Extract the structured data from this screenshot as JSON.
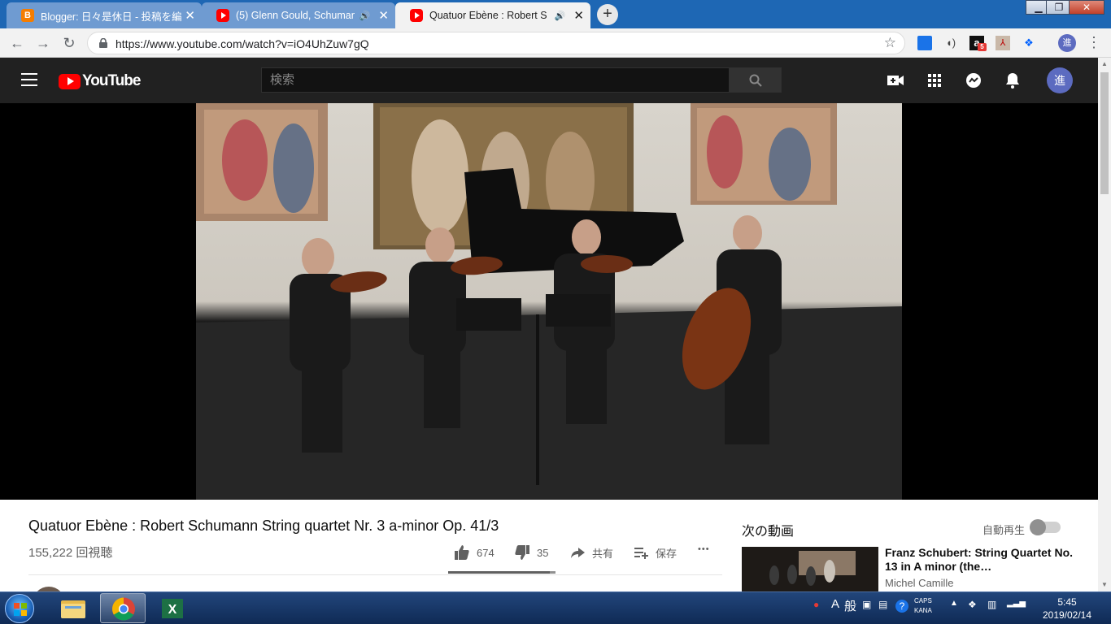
{
  "browser": {
    "tabs": [
      {
        "title": "Blogger: 日々是休日 - 投稿を編",
        "icon": "blogger-icon",
        "audio": false,
        "active": false
      },
      {
        "title": "(5) Glenn Gould, Schuman",
        "icon": "youtube-icon",
        "audio": true,
        "active": false
      },
      {
        "title": "Quatuor Ebène : Robert S",
        "icon": "youtube-icon",
        "audio": true,
        "active": true
      }
    ],
    "close_glyph": "✕",
    "new_tab_glyph": "+",
    "url": "https://www.youtube.com/watch?v=iO4UhZuw7gQ",
    "profile_initial": "進",
    "amazon_badge": "5"
  },
  "youtube": {
    "logo_text": "YouTube",
    "search_placeholder": "検索",
    "avatar_initial": "進",
    "video": {
      "title": "Quatuor Ebène : Robert Schumann String quartet Nr. 3 a-minor Op. 41/3",
      "views": "155,222 回視聴",
      "likes": "674",
      "dislikes": "35",
      "like_ratio": 0.95,
      "share_label": "共有",
      "save_label": "保存",
      "more_glyph": "•••"
    },
    "up_next": {
      "heading": "次の動画",
      "autoplay_label": "自動再生",
      "autoplay_on": false,
      "items": [
        {
          "title": "Franz Schubert: String Quartet No. 13 in A minor (the…",
          "channel": "Michel Camille"
        }
      ]
    }
  },
  "taskbar": {
    "time": "5:45",
    "date": "2019/02/14",
    "ime_mode": "A",
    "ime_label": "般",
    "caps": "CAPS",
    "kana": "KANA"
  },
  "colors": {
    "tab_strip": "#1e67b4",
    "yt_red": "#ff0000",
    "masthead": "#212121"
  }
}
